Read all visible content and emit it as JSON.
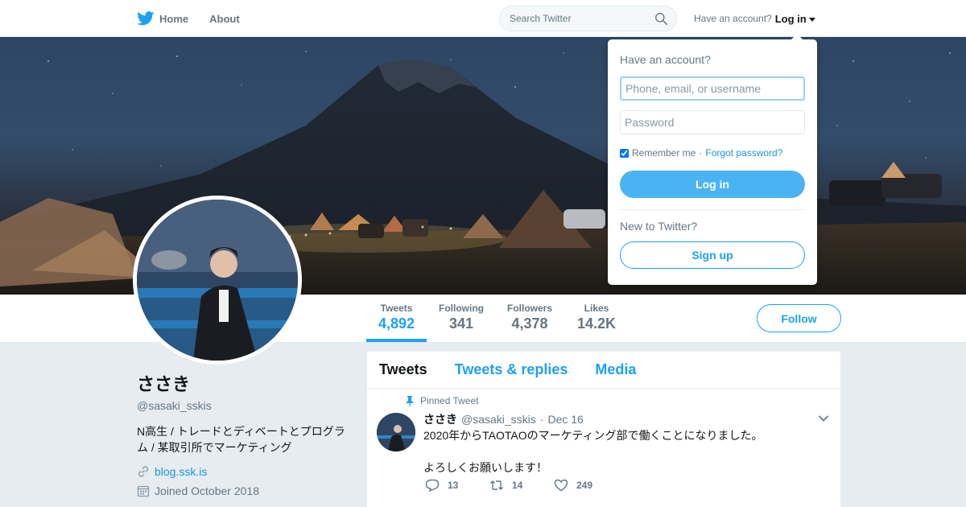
{
  "nav": {
    "home_label": "Home",
    "about_label": "About",
    "search_placeholder": "Search Twitter",
    "have_account_label": "Have an account?",
    "login_label": "Log in"
  },
  "stats": {
    "tweets_label": "Tweets",
    "tweets_value": "4,892",
    "following_label": "Following",
    "following_value": "341",
    "followers_label": "Followers",
    "followers_value": "4,378",
    "likes_label": "Likes",
    "likes_value": "14.2K",
    "follow_button": "Follow"
  },
  "profile": {
    "name": "ささき",
    "handle": "@sasaki_sskis",
    "bio": "N高生 / トレードとディベートとプログラム / 某取引所でマーケティング",
    "url": "blog.ssk.is",
    "joined": "Joined October 2018"
  },
  "timeline": {
    "tabs": [
      "Tweets",
      "Tweets & replies",
      "Media"
    ],
    "tweet": {
      "pinned_label": "Pinned Tweet",
      "name": "ささき",
      "handle": "@sasaki_sskis",
      "separator": "·",
      "date": "Dec 16",
      "line1": "2020年からTAOTAOのマーケティング部で働くことになりました。",
      "line2": "よろしくお願いします！",
      "replies": "13",
      "retweets": "14",
      "likes": "249"
    }
  },
  "login_dropdown": {
    "title": "Have an account?",
    "username_placeholder": "Phone, email, or username",
    "password_placeholder": "Password",
    "remember_label": "Remember me",
    "separator": "·",
    "forgot_label": "Forgot password?",
    "login_button": "Log in",
    "new_label": "New to Twitter?",
    "signup_button": "Sign up"
  },
  "colors": {
    "accent": "#1da1f2",
    "background": "#e6ecf0",
    "text_secondary": "#657786"
  },
  "icons": [
    "twitter-bird-icon",
    "home-icon",
    "search-icon",
    "caret-down-icon",
    "link-icon",
    "calendar-icon",
    "pin-icon",
    "chevron-down-icon",
    "reply-icon",
    "retweet-icon",
    "like-icon"
  ]
}
